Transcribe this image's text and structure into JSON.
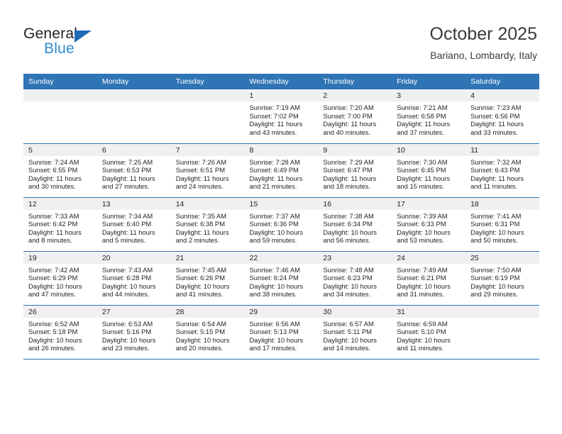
{
  "brand": {
    "name_top": "General",
    "name_bottom": "Blue",
    "triangle_color": "#1e6bb8",
    "blue_text_color": "#2e8bd0"
  },
  "header": {
    "title": "October 2025",
    "subtitle": "Bariano, Lombardy, Italy"
  },
  "colors": {
    "header_row_bg": "#2f74b5",
    "daynum_band_bg": "#f0f0f0",
    "row_border": "#2f74b5",
    "text": "#231f20"
  },
  "calendar": {
    "weekday_headers": [
      "Sunday",
      "Monday",
      "Tuesday",
      "Wednesday",
      "Thursday",
      "Friday",
      "Saturday"
    ],
    "labels": {
      "sunrise": "Sunrise:",
      "sunset": "Sunset:",
      "daylight": "Daylight:"
    },
    "weeks": [
      [
        {
          "day": "",
          "empty": true
        },
        {
          "day": "",
          "empty": true
        },
        {
          "day": "",
          "empty": true
        },
        {
          "day": "1",
          "sunrise": "Sunrise: 7:19 AM",
          "sunset": "Sunset: 7:02 PM",
          "daylight_l1": "Daylight: 11 hours",
          "daylight_l2": "and 43 minutes."
        },
        {
          "day": "2",
          "sunrise": "Sunrise: 7:20 AM",
          "sunset": "Sunset: 7:00 PM",
          "daylight_l1": "Daylight: 11 hours",
          "daylight_l2": "and 40 minutes."
        },
        {
          "day": "3",
          "sunrise": "Sunrise: 7:21 AM",
          "sunset": "Sunset: 6:58 PM",
          "daylight_l1": "Daylight: 11 hours",
          "daylight_l2": "and 37 minutes."
        },
        {
          "day": "4",
          "sunrise": "Sunrise: 7:23 AM",
          "sunset": "Sunset: 6:56 PM",
          "daylight_l1": "Daylight: 11 hours",
          "daylight_l2": "and 33 minutes."
        }
      ],
      [
        {
          "day": "5",
          "sunrise": "Sunrise: 7:24 AM",
          "sunset": "Sunset: 6:55 PM",
          "daylight_l1": "Daylight: 11 hours",
          "daylight_l2": "and 30 minutes."
        },
        {
          "day": "6",
          "sunrise": "Sunrise: 7:25 AM",
          "sunset": "Sunset: 6:53 PM",
          "daylight_l1": "Daylight: 11 hours",
          "daylight_l2": "and 27 minutes."
        },
        {
          "day": "7",
          "sunrise": "Sunrise: 7:26 AM",
          "sunset": "Sunset: 6:51 PM",
          "daylight_l1": "Daylight: 11 hours",
          "daylight_l2": "and 24 minutes."
        },
        {
          "day": "8",
          "sunrise": "Sunrise: 7:28 AM",
          "sunset": "Sunset: 6:49 PM",
          "daylight_l1": "Daylight: 11 hours",
          "daylight_l2": "and 21 minutes."
        },
        {
          "day": "9",
          "sunrise": "Sunrise: 7:29 AM",
          "sunset": "Sunset: 6:47 PM",
          "daylight_l1": "Daylight: 11 hours",
          "daylight_l2": "and 18 minutes."
        },
        {
          "day": "10",
          "sunrise": "Sunrise: 7:30 AM",
          "sunset": "Sunset: 6:45 PM",
          "daylight_l1": "Daylight: 11 hours",
          "daylight_l2": "and 15 minutes."
        },
        {
          "day": "11",
          "sunrise": "Sunrise: 7:32 AM",
          "sunset": "Sunset: 6:43 PM",
          "daylight_l1": "Daylight: 11 hours",
          "daylight_l2": "and 11 minutes."
        }
      ],
      [
        {
          "day": "12",
          "sunrise": "Sunrise: 7:33 AM",
          "sunset": "Sunset: 6:42 PM",
          "daylight_l1": "Daylight: 11 hours",
          "daylight_l2": "and 8 minutes."
        },
        {
          "day": "13",
          "sunrise": "Sunrise: 7:34 AM",
          "sunset": "Sunset: 6:40 PM",
          "daylight_l1": "Daylight: 11 hours",
          "daylight_l2": "and 5 minutes."
        },
        {
          "day": "14",
          "sunrise": "Sunrise: 7:35 AM",
          "sunset": "Sunset: 6:38 PM",
          "daylight_l1": "Daylight: 11 hours",
          "daylight_l2": "and 2 minutes."
        },
        {
          "day": "15",
          "sunrise": "Sunrise: 7:37 AM",
          "sunset": "Sunset: 6:36 PM",
          "daylight_l1": "Daylight: 10 hours",
          "daylight_l2": "and 59 minutes."
        },
        {
          "day": "16",
          "sunrise": "Sunrise: 7:38 AM",
          "sunset": "Sunset: 6:34 PM",
          "daylight_l1": "Daylight: 10 hours",
          "daylight_l2": "and 56 minutes."
        },
        {
          "day": "17",
          "sunrise": "Sunrise: 7:39 AM",
          "sunset": "Sunset: 6:33 PM",
          "daylight_l1": "Daylight: 10 hours",
          "daylight_l2": "and 53 minutes."
        },
        {
          "day": "18",
          "sunrise": "Sunrise: 7:41 AM",
          "sunset": "Sunset: 6:31 PM",
          "daylight_l1": "Daylight: 10 hours",
          "daylight_l2": "and 50 minutes."
        }
      ],
      [
        {
          "day": "19",
          "sunrise": "Sunrise: 7:42 AM",
          "sunset": "Sunset: 6:29 PM",
          "daylight_l1": "Daylight: 10 hours",
          "daylight_l2": "and 47 minutes."
        },
        {
          "day": "20",
          "sunrise": "Sunrise: 7:43 AM",
          "sunset": "Sunset: 6:28 PM",
          "daylight_l1": "Daylight: 10 hours",
          "daylight_l2": "and 44 minutes."
        },
        {
          "day": "21",
          "sunrise": "Sunrise: 7:45 AM",
          "sunset": "Sunset: 6:26 PM",
          "daylight_l1": "Daylight: 10 hours",
          "daylight_l2": "and 41 minutes."
        },
        {
          "day": "22",
          "sunrise": "Sunrise: 7:46 AM",
          "sunset": "Sunset: 6:24 PM",
          "daylight_l1": "Daylight: 10 hours",
          "daylight_l2": "and 38 minutes."
        },
        {
          "day": "23",
          "sunrise": "Sunrise: 7:48 AM",
          "sunset": "Sunset: 6:23 PM",
          "daylight_l1": "Daylight: 10 hours",
          "daylight_l2": "and 34 minutes."
        },
        {
          "day": "24",
          "sunrise": "Sunrise: 7:49 AM",
          "sunset": "Sunset: 6:21 PM",
          "daylight_l1": "Daylight: 10 hours",
          "daylight_l2": "and 31 minutes."
        },
        {
          "day": "25",
          "sunrise": "Sunrise: 7:50 AM",
          "sunset": "Sunset: 6:19 PM",
          "daylight_l1": "Daylight: 10 hours",
          "daylight_l2": "and 29 minutes."
        }
      ],
      [
        {
          "day": "26",
          "sunrise": "Sunrise: 6:52 AM",
          "sunset": "Sunset: 5:18 PM",
          "daylight_l1": "Daylight: 10 hours",
          "daylight_l2": "and 26 minutes."
        },
        {
          "day": "27",
          "sunrise": "Sunrise: 6:53 AM",
          "sunset": "Sunset: 5:16 PM",
          "daylight_l1": "Daylight: 10 hours",
          "daylight_l2": "and 23 minutes."
        },
        {
          "day": "28",
          "sunrise": "Sunrise: 6:54 AM",
          "sunset": "Sunset: 5:15 PM",
          "daylight_l1": "Daylight: 10 hours",
          "daylight_l2": "and 20 minutes."
        },
        {
          "day": "29",
          "sunrise": "Sunrise: 6:56 AM",
          "sunset": "Sunset: 5:13 PM",
          "daylight_l1": "Daylight: 10 hours",
          "daylight_l2": "and 17 minutes."
        },
        {
          "day": "30",
          "sunrise": "Sunrise: 6:57 AM",
          "sunset": "Sunset: 5:11 PM",
          "daylight_l1": "Daylight: 10 hours",
          "daylight_l2": "and 14 minutes."
        },
        {
          "day": "31",
          "sunrise": "Sunrise: 6:59 AM",
          "sunset": "Sunset: 5:10 PM",
          "daylight_l1": "Daylight: 10 hours",
          "daylight_l2": "and 11 minutes."
        },
        {
          "day": "",
          "empty": true
        }
      ]
    ]
  }
}
